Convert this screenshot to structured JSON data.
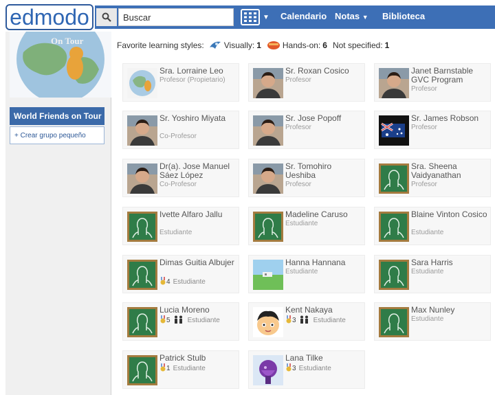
{
  "header": {
    "logo": "edmodo",
    "search_placeholder": "Buscar",
    "nav": [
      {
        "label": "Calendario"
      },
      {
        "label": "Notas"
      },
      {
        "label": "Biblioteca"
      }
    ]
  },
  "group": {
    "avatar_text": "On Tour",
    "name": "World Friends on Tour",
    "create_small_group": "+ Crear grupo pequeño"
  },
  "learning_styles": {
    "label": "Favorite learning styles:",
    "visually_label": "Visually:",
    "visually_count": "1",
    "hands_on_label": "Hands-on:",
    "hands_on_count": "6",
    "not_specified_label": "Not specified:",
    "not_specified_count": "1"
  },
  "members": [
    {
      "name": "Sra. Lorraine Leo",
      "role": "Profesor (Propietario)",
      "pic": "group-logo"
    },
    {
      "name": "Sr. Roxan Cosico",
      "role": "Profesor",
      "pic": "photo"
    },
    {
      "name": "Janet Barnstable GVC Program",
      "role": "Profesor",
      "pic": "photo"
    },
    {
      "name": "Sr. Yoshiro Miyata",
      "role": "Co-Profesor",
      "pic": "photo"
    },
    {
      "name": "Sr. Jose Popoff",
      "role": "Profesor",
      "pic": "photo"
    },
    {
      "name": "Sr. James Robson",
      "role": "Profesor",
      "pic": "flag"
    },
    {
      "name": "Dr(a). Jose Manuel Sáez López",
      "role": "Co-Profesor",
      "pic": "photo"
    },
    {
      "name": "Sr. Tomohiro Ueshiba",
      "role": "Profesor",
      "pic": "photo"
    },
    {
      "name": "Sra. Sheena Vaidyanathan",
      "role": "Profesor",
      "pic": "chalkboard"
    },
    {
      "name": "Ivette Alfaro Jallu",
      "role": "Estudiante",
      "pic": "chalkboard"
    },
    {
      "name": "Madeline Caruso",
      "role": "Estudiante",
      "pic": "chalkboard"
    },
    {
      "name": "Blaine Vinton Cosico",
      "role": "Estudiante",
      "pic": "chalkboard"
    },
    {
      "name": "Dimas Guitia Albujer",
      "role": "Estudiante",
      "badge_count": "4",
      "pic": "chalkboard"
    },
    {
      "name": "Hanna Hannana",
      "role": "Estudiante",
      "pic": "landscape"
    },
    {
      "name": "Sara Harris",
      "role": "Estudiante",
      "pic": "chalkboard"
    },
    {
      "name": "Lucia Moreno",
      "role": "Estudiante",
      "badge_count": "5",
      "pic": "chalkboard"
    },
    {
      "name": "Kent Nakaya",
      "role": "Estudiante",
      "badge_count": "3",
      "pic": "cartoon"
    },
    {
      "name": "Max Nunley",
      "role": "Estudiante",
      "pic": "chalkboard"
    },
    {
      "name": "Patrick Stulb",
      "role": "Estudiante",
      "badge_count": "1",
      "pic": "chalkboard"
    },
    {
      "name": "Lana Tilke",
      "role": "Estudiante",
      "badge_count": "3",
      "pic": "purple-avatar"
    }
  ],
  "colors": {
    "header_blue": "#3d6fb6",
    "group_name_bg": "#3b6aa9",
    "chalkboard_green": "#2d7a47",
    "chalkboard_frame": "#8a6a3a"
  }
}
